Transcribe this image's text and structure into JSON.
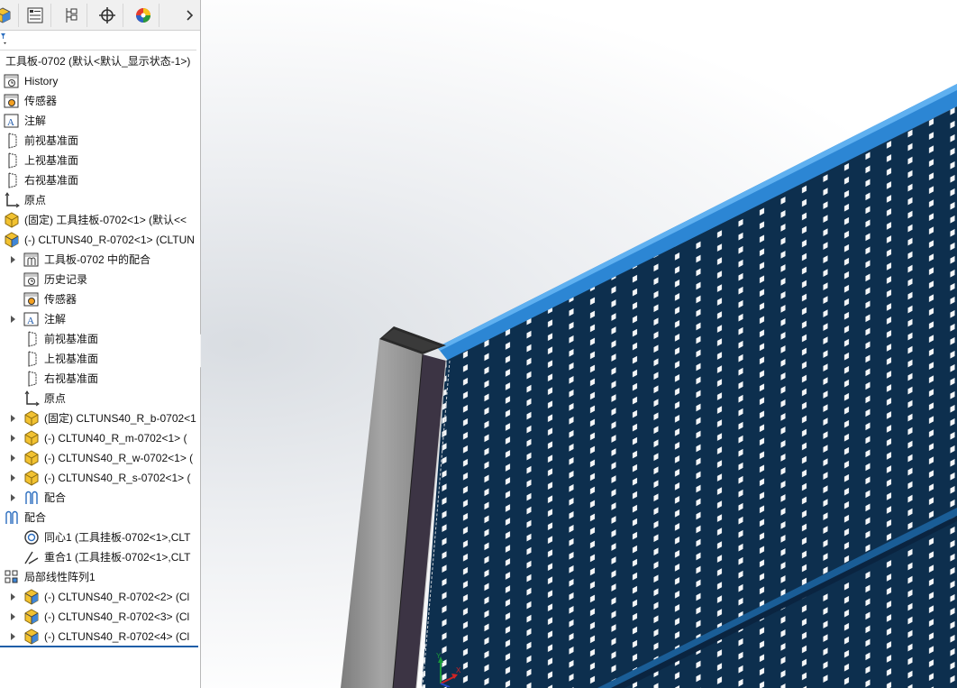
{
  "tabs": [
    {
      "name": "feature-manager-tab",
      "icon": "part-cube-icon"
    },
    {
      "name": "property-manager-tab",
      "icon": "property-list-icon"
    },
    {
      "name": "configuration-manager-tab",
      "icon": "configuration-icon"
    },
    {
      "name": "dimxpert-tab",
      "icon": "crosshair-icon"
    },
    {
      "name": "display-manager-tab",
      "icon": "color-wheel-icon"
    }
  ],
  "tree": {
    "root": "工具板-0702 (默认<默认_显示状态-1>)",
    "items": [
      {
        "label": "History",
        "icon": "history-icon",
        "indent": 0,
        "arrow": false
      },
      {
        "label": "传感器",
        "icon": "sensor-icon",
        "indent": 0,
        "arrow": false
      },
      {
        "label": "注解",
        "icon": "annotation-icon",
        "indent": 0,
        "arrow": false
      },
      {
        "label": "前视基准面",
        "icon": "plane-icon",
        "indent": 0,
        "arrow": false
      },
      {
        "label": "上视基准面",
        "icon": "plane-icon",
        "indent": 0,
        "arrow": false
      },
      {
        "label": "右视基准面",
        "icon": "plane-icon",
        "indent": 0,
        "arrow": false
      },
      {
        "label": "原点",
        "icon": "origin-icon",
        "indent": 0,
        "arrow": false
      },
      {
        "label": "(固定) 工具挂板-0702<1> (默认<<",
        "icon": "part-icon",
        "indent": 0,
        "arrow": false
      },
      {
        "label": "(-) CLTUNS40_R-0702<1> (CLTUN",
        "icon": "subassembly-icon",
        "indent": 0,
        "arrow": false
      },
      {
        "label": "工具板-0702 中的配合",
        "icon": "mates-folder-icon",
        "indent": 1,
        "arrow": true
      },
      {
        "label": "历史记录",
        "icon": "history-icon",
        "indent": 1,
        "arrow": false
      },
      {
        "label": "传感器",
        "icon": "sensor-icon",
        "indent": 1,
        "arrow": false
      },
      {
        "label": "注解",
        "icon": "annotation-icon",
        "indent": 1,
        "arrow": true
      },
      {
        "label": "前视基准面",
        "icon": "plane-icon",
        "indent": 1,
        "arrow": false
      },
      {
        "label": "上视基准面",
        "icon": "plane-icon",
        "indent": 1,
        "arrow": false
      },
      {
        "label": "右视基准面",
        "icon": "plane-icon",
        "indent": 1,
        "arrow": false
      },
      {
        "label": "原点",
        "icon": "origin-icon",
        "indent": 1,
        "arrow": false
      },
      {
        "label": "(固定) CLTUNS40_R_b-0702<1",
        "icon": "part-icon",
        "indent": 1,
        "arrow": true
      },
      {
        "label": "(-) CLTUN40_R_m-0702<1> (",
        "icon": "part-icon",
        "indent": 1,
        "arrow": true
      },
      {
        "label": "(-) CLTUNS40_R_w-0702<1> (",
        "icon": "part-icon",
        "indent": 1,
        "arrow": true
      },
      {
        "label": "(-) CLTUNS40_R_s-0702<1> (",
        "icon": "part-icon",
        "indent": 1,
        "arrow": true
      },
      {
        "label": "配合",
        "icon": "mates-icon",
        "indent": 1,
        "arrow": true
      },
      {
        "label": "配合",
        "icon": "mates-icon",
        "indent": 0,
        "arrow": false
      },
      {
        "label": "同心1 (工具挂板-0702<1>,CLT",
        "icon": "concentric-icon",
        "indent": 1,
        "arrow": false
      },
      {
        "label": "重合1 (工具挂板-0702<1>,CLT",
        "icon": "coincident-icon",
        "indent": 1,
        "arrow": false
      },
      {
        "label": "局部线性阵列1",
        "icon": "linear-pattern-icon",
        "indent": 0,
        "arrow": false
      },
      {
        "label": "(-) CLTUNS40_R-0702<2> (Cl",
        "icon": "subassembly-icon",
        "indent": 1,
        "arrow": true
      },
      {
        "label": "(-) CLTUNS40_R-0702<3> (Cl",
        "icon": "subassembly-icon",
        "indent": 1,
        "arrow": true
      },
      {
        "label": "(-) CLTUNS40_R-0702<4> (Cl",
        "icon": "subassembly-icon",
        "indent": 1,
        "arrow": true
      }
    ]
  },
  "triad": {
    "x": "X",
    "y": "Y"
  },
  "colors": {
    "board": "#0d2f4e",
    "rail": "#2c86d4",
    "post": "#8f8f8f",
    "post_dark": "#3c3444",
    "selection": "#1f5ea8"
  }
}
